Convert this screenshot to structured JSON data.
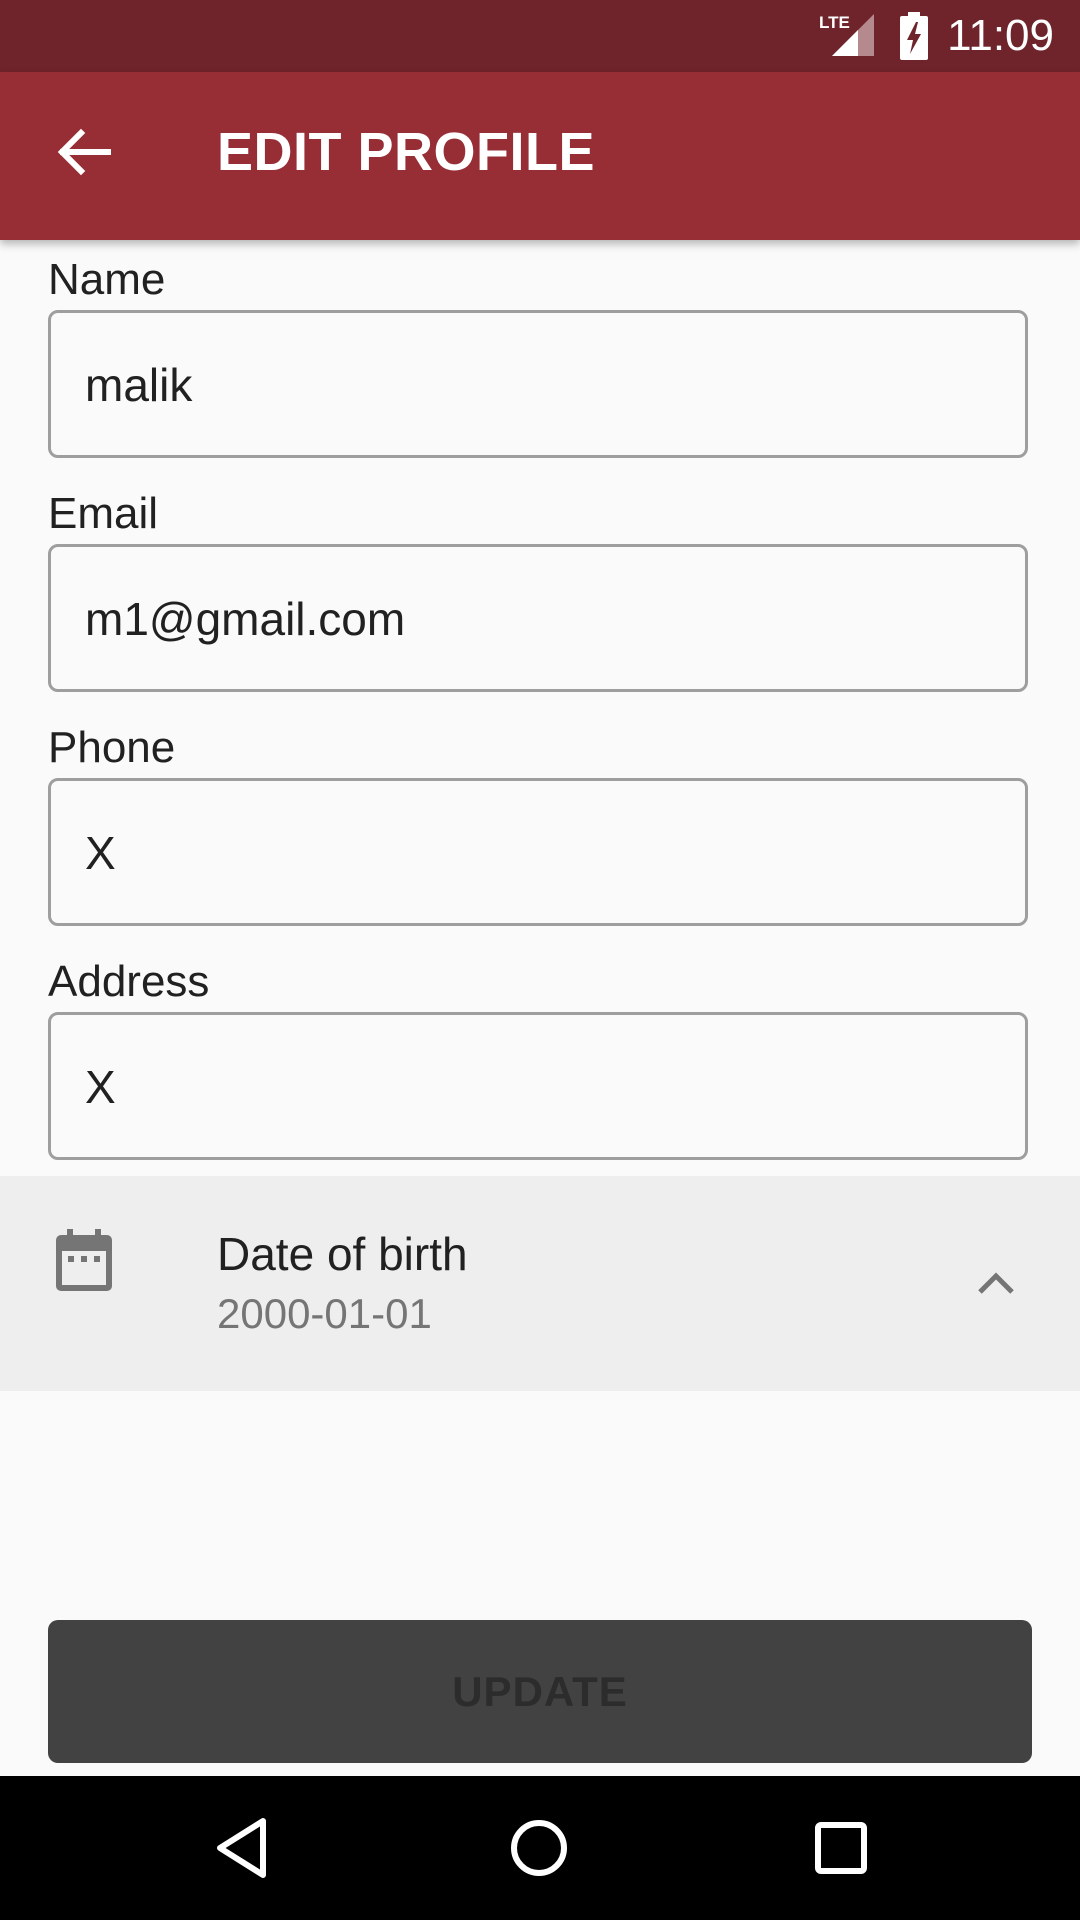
{
  "status_bar": {
    "network": "LTE",
    "time": "11:09"
  },
  "app_bar": {
    "title": "EDIT PROFILE",
    "back_icon": "arrow-back-icon"
  },
  "form": {
    "fields": [
      {
        "label": "Name",
        "value": "malik"
      },
      {
        "label": "Email",
        "value": "m1@gmail.com"
      },
      {
        "label": "Phone",
        "value": "X"
      },
      {
        "label": "Address",
        "value": "X"
      }
    ]
  },
  "date_of_birth": {
    "label": "Date of birth",
    "value": "2000-01-01",
    "icon": "calendar-icon",
    "toggle_icon": "chevron-up-icon"
  },
  "update_button": {
    "label": "UPDATE"
  },
  "nav_bar": {
    "icons": [
      "nav-back-icon",
      "nav-home-icon",
      "nav-recents-icon"
    ]
  },
  "colors": {
    "status_bar": "#6f232a",
    "app_bar": "#972e36",
    "background": "#fafafa",
    "dob_panel": "#eeeeee",
    "button": "#424242"
  }
}
